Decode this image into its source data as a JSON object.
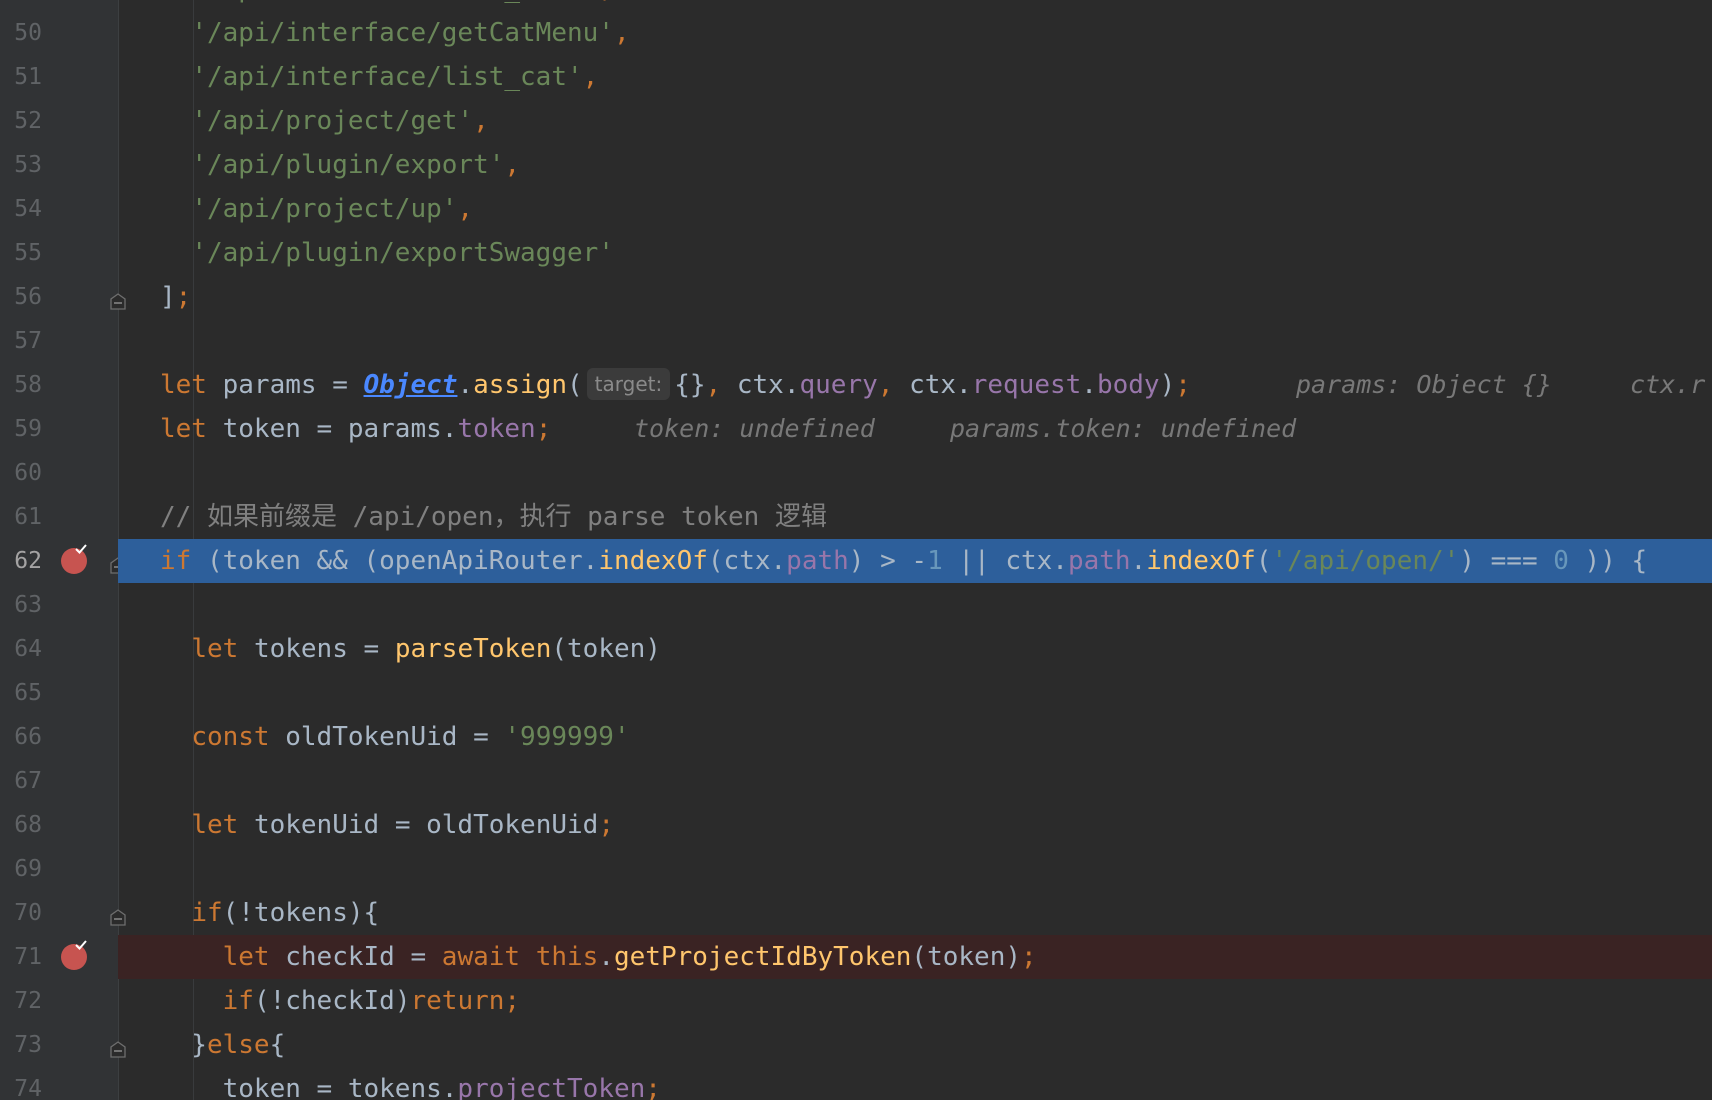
{
  "editor": {
    "lines": [
      {
        "n": "50",
        "html": "  <span class=\"str\">'/api/interface/getCatMenu'</span><span class=\"kw\">,</span>"
      },
      {
        "n": "51",
        "html": "  <span class=\"str\">'/api/interface/list_cat'</span><span class=\"kw\">,</span>"
      },
      {
        "n": "52",
        "html": "  <span class=\"str\">'/api/project/get'</span><span class=\"kw\">,</span>"
      },
      {
        "n": "53",
        "html": "  <span class=\"str\">'/api/plugin/export'</span><span class=\"kw\">,</span>"
      },
      {
        "n": "54",
        "html": "  <span class=\"str\">'/api/project/up'</span><span class=\"kw\">,</span>"
      },
      {
        "n": "55",
        "html": "  <span class=\"str\">'/api/plugin/exportSwagger'</span>"
      },
      {
        "n": "56",
        "html": "]<span class=\"kw\">;</span>"
      },
      {
        "n": "57",
        "html": ""
      },
      {
        "n": "58",
        "html": "<span class=\"kw\">let </span>params = <span class=\"obj\">Object</span>.<span class=\"fn\">assign</span>(<span class=\"hint\">target:</span>{}<span class=\"kw\">, </span>ctx.<span class=\"prop\">query</span><span class=\"kw\">, </span>ctx.<span class=\"prop\">request</span>.<span class=\"prop\">body</span>)<span class=\"kw\">;</span>"
      },
      {
        "n": "59",
        "html": "<span class=\"kw\">let </span>token = params.<span class=\"prop\">token</span><span class=\"kw\">;</span>"
      },
      {
        "n": "60",
        "html": ""
      },
      {
        "n": "61",
        "html": "<span class=\"cm\">// 如果前缀是 /api/open，执行 parse token 逻辑</span>"
      },
      {
        "n": "62",
        "html": "<span class=\"kw\">if </span>(token &amp;&amp; (openApiRouter.<span class=\"fn\">indexOf</span>(ctx.<span class=\"prop\">path</span>) &gt; -<span class=\"num\">1</span> || ctx.<span class=\"prop\">path</span>.<span class=\"fn\">indexOf</span>(<span class=\"str\">'/api/open/'</span>) === <span class=\"num\">0</span> )) {"
      },
      {
        "n": "63",
        "html": ""
      },
      {
        "n": "64",
        "html": "  <span class=\"kw\">let </span>tokens = <span class=\"fn\">parseToken</span>(token)"
      },
      {
        "n": "65",
        "html": ""
      },
      {
        "n": "66",
        "html": "  <span class=\"kw\">const </span>oldTokenUid = <span class=\"str\">'999999'</span>"
      },
      {
        "n": "67",
        "html": ""
      },
      {
        "n": "68",
        "html": "  <span class=\"kw\">let </span>tokenUid = oldTokenUid<span class=\"kw\">;</span>"
      },
      {
        "n": "69",
        "html": ""
      },
      {
        "n": "70",
        "html": "  <span class=\"kw\">if</span>(!tokens){"
      },
      {
        "n": "71",
        "html": "    <span class=\"kw\">let </span>checkId = <span class=\"kw\">await this</span>.<span class=\"fn\">getProjectIdByToken</span>(token)<span class=\"kw\">;</span>"
      },
      {
        "n": "72",
        "html": "    <span class=\"kw\">if</span>(!checkId)<span class=\"kw\">return;</span>"
      },
      {
        "n": "73",
        "html": "  }<span class=\"kw\">else</span>{"
      },
      {
        "n": "74",
        "html": "    token = tokens.<span class=\"prop\">projectToken</span><span class=\"kw\">;</span>"
      }
    ],
    "top_partial": "  <span class=\"str\">'/api/interface/list_menu'</span><span class=\"kw\">,</span>",
    "inlays": {
      "58": [
        "params: Object {}",
        "ctx.r"
      ],
      "59": [
        "token: undefined",
        "params.token: undefined"
      ]
    },
    "breakpoints": [
      "62",
      "71"
    ],
    "folds": [
      "56",
      "62",
      "70",
      "73"
    ],
    "execution_line": "62",
    "colors": {
      "background": "#2b2b2b",
      "execution_highlight": "#2d5f9b",
      "breakpoint": "#c75450",
      "breakpoint_line": "#3a2323"
    }
  }
}
